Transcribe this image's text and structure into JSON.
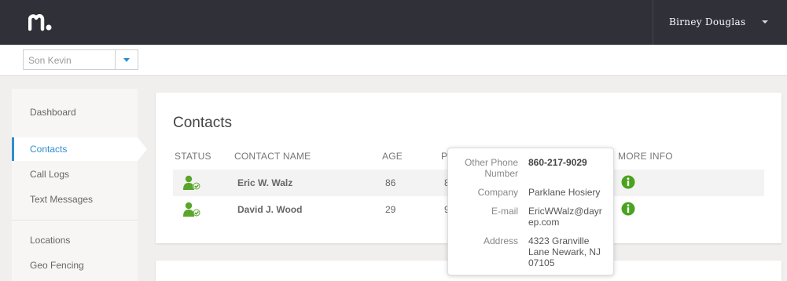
{
  "header": {
    "logo_icon": "mspy-logo-icon",
    "user_name": "Birney Douglas"
  },
  "device_selector": {
    "value": "Son Kevin"
  },
  "sidebar": {
    "items": [
      {
        "label": "Dashboard",
        "active": false
      },
      {
        "label": "Contacts",
        "active": true
      },
      {
        "label": "Call Logs",
        "active": false
      },
      {
        "label": "Text Messages",
        "active": false
      },
      {
        "label": "Locations",
        "active": false
      },
      {
        "label": "Geo Fencing",
        "active": false
      }
    ],
    "accent_color": "#2e8fd1"
  },
  "contacts": {
    "title": "Contacts",
    "columns": {
      "status": "STATUS",
      "name": "CONTACT NAME",
      "age": "AGE",
      "phone": "P",
      "more_info": "MORE INFO"
    },
    "rows": [
      {
        "name": "Eric W. Walz",
        "age": "86",
        "phone_partial": "8",
        "status_icon": "contact-verified-icon",
        "info_icon": "info-icon"
      },
      {
        "name": "David J. Wood",
        "age": "29",
        "phone_partial": "9",
        "status_icon": "contact-verified-icon",
        "info_icon": "info-icon"
      }
    ]
  },
  "popover": {
    "other_phone_label_1": "Other Phone",
    "other_phone_label_2": "Number",
    "other_phone": "860-217-9029",
    "company_label": "Company",
    "company": "Parklane Hosiery",
    "email_label": "E-mail",
    "email_1": "EricWWalz@dayr",
    "email_2": "ep.com",
    "address_label": "Address",
    "address_1": "4323 Granville",
    "address_2": "Lane Newark, NJ",
    "address_3": "07105"
  }
}
